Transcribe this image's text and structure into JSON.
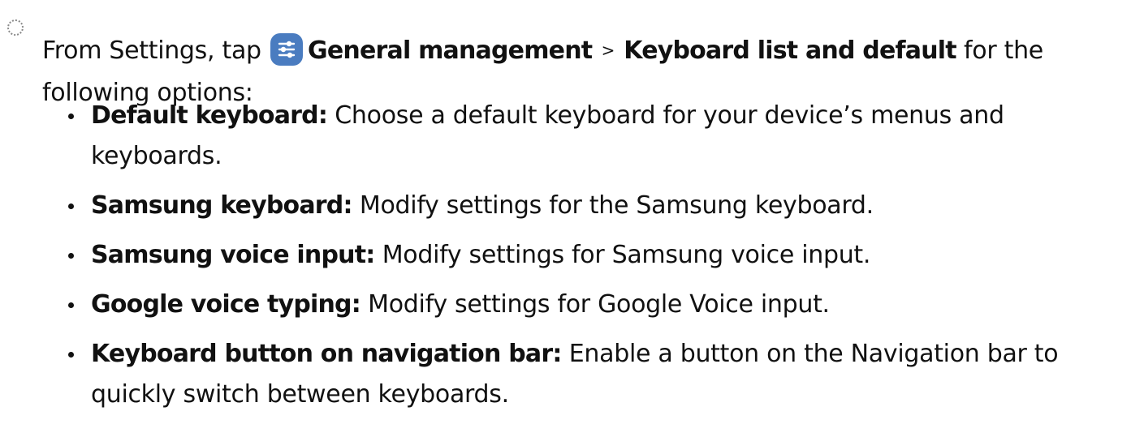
{
  "step": {
    "intro": "From Settings, tap",
    "icon": "settings-sliders-icon",
    "icon_color": "#4a7cc0",
    "menu_1": "General management",
    "separator": ">",
    "menu_2": "Keyboard list and default",
    "outro": "for the following options:"
  },
  "options": [
    {
      "term": "Default keyboard",
      "colon": ":",
      "text": "Choose a default keyboard for your device’s menus and keyboards."
    },
    {
      "term": "Samsung keyboard",
      "colon": ":",
      "text": "Modify settings for the Samsung keyboard."
    },
    {
      "term": "Samsung voice input",
      "colon": ":",
      "text": "Modify settings for Samsung voice input."
    },
    {
      "term": "Google voice typing",
      "colon": ":",
      "text": "Modify settings for Google Voice input."
    },
    {
      "term": "Keyboard button on navigation bar",
      "colon": ":",
      "text": "Enable a button on the Navigation bar to quickly switch between keyboards."
    }
  ]
}
